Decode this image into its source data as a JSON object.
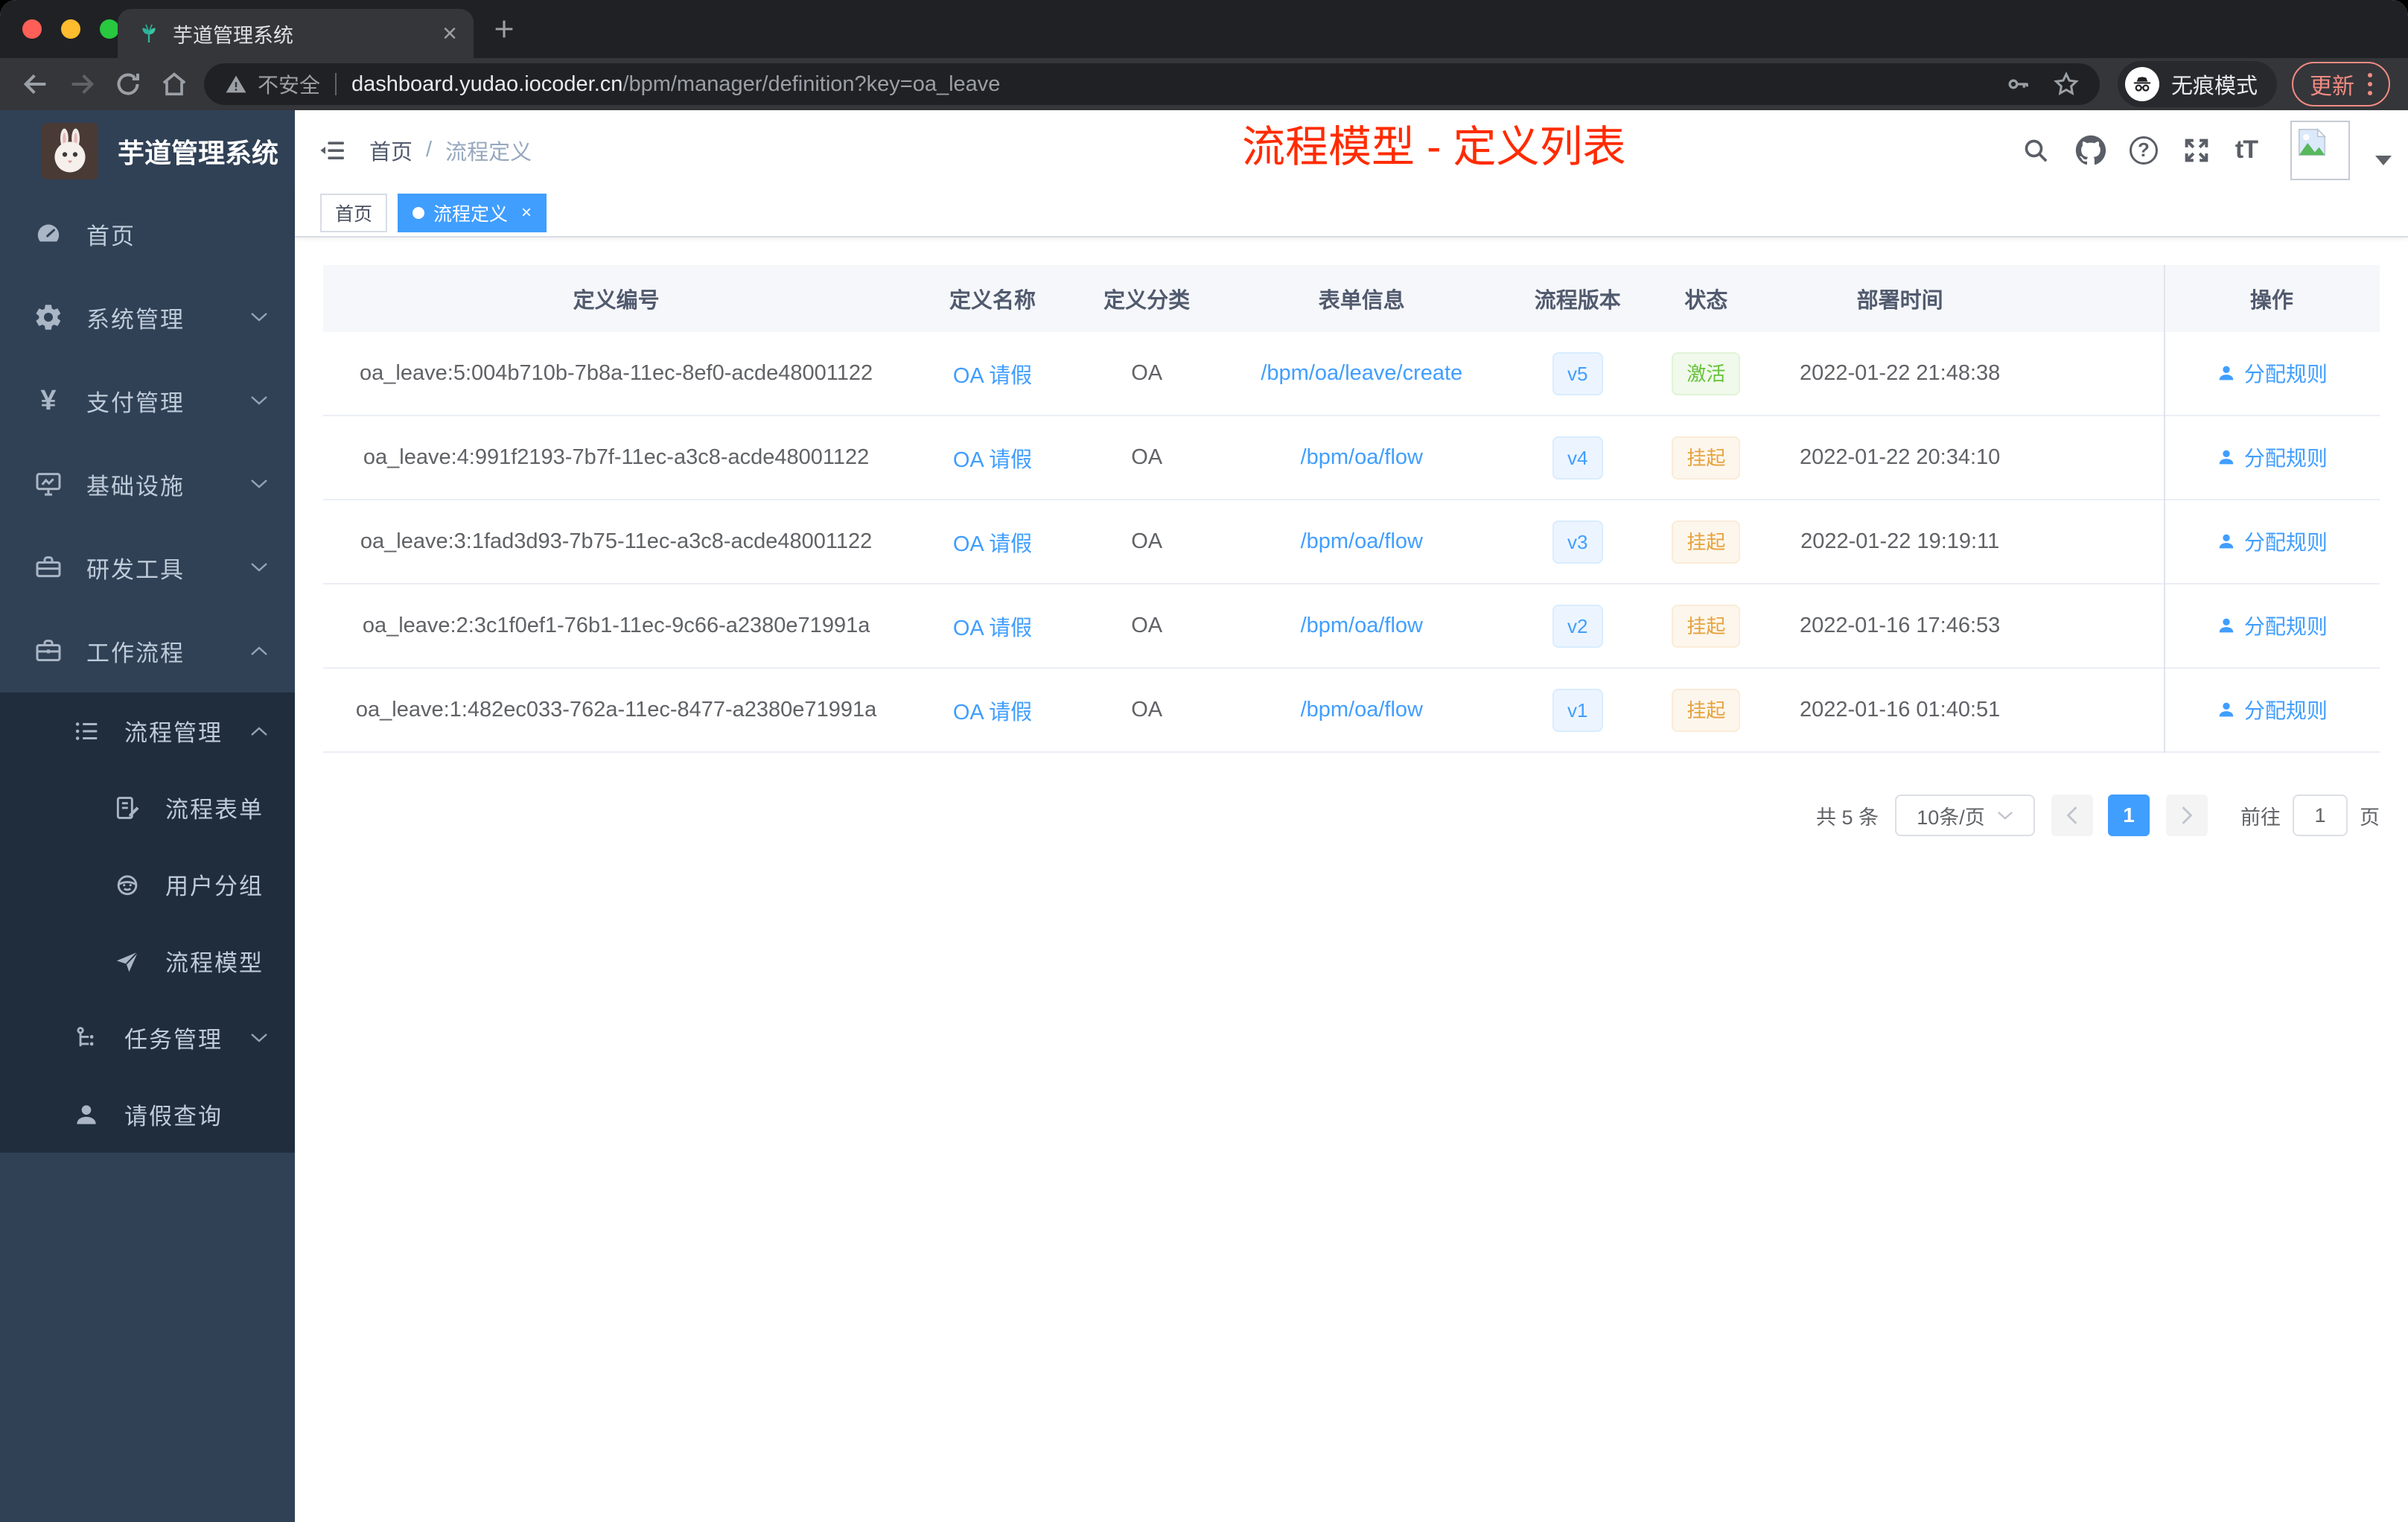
{
  "browser": {
    "tab": {
      "title": "芋道管理系统",
      "close": "×"
    },
    "toolbar": {
      "security_label": "不安全",
      "url_host": "dashboard.yudao.iocoder.cn",
      "url_path": "/bpm/manager/definition?key=oa_leave",
      "incognito_label": "无痕模式",
      "update_label": "更新"
    }
  },
  "sidebar": {
    "logo_title": "芋道管理系统",
    "menu": [
      {
        "label": "首页",
        "icon": "gauge-icon"
      },
      {
        "label": "系统管理",
        "icon": "gear-icon"
      },
      {
        "label": "支付管理",
        "icon": "yen-icon"
      },
      {
        "label": "基础设施",
        "icon": "monitor-icon"
      },
      {
        "label": "研发工具",
        "icon": "toolbox-icon"
      },
      {
        "label": "工作流程",
        "icon": "briefcase-icon"
      }
    ],
    "submenu": [
      {
        "label": "流程管理",
        "icon": "list-icon"
      },
      {
        "label": "流程表单",
        "icon": "form-icon"
      },
      {
        "label": "用户分组",
        "icon": "robot-icon"
      },
      {
        "label": "流程模型",
        "icon": "plane-icon"
      },
      {
        "label": "任务管理",
        "icon": "tree-icon"
      },
      {
        "label": "请假查询",
        "icon": "user-icon"
      }
    ]
  },
  "navbar": {
    "breadcrumb": {
      "items": [
        "首页",
        "流程定义"
      ],
      "separator": "/"
    },
    "annotation": {
      "text": "流程模型 - 定义列表",
      "color": "#ff2b00"
    }
  },
  "tags": [
    {
      "label": "首页",
      "active": false
    },
    {
      "label": "流程定义",
      "active": true,
      "close": "×"
    }
  ],
  "table": {
    "columns": [
      "定义编号",
      "定义名称",
      "定义分类",
      "表单信息",
      "流程版本",
      "状态",
      "部署时间",
      "操作"
    ],
    "rows": [
      {
        "id": "oa_leave:5:004b710b-7b8a-11ec-8ef0-acde48001122",
        "name": "OA 请假",
        "category": "OA",
        "form": "/bpm/oa/leave/create",
        "version": "v5",
        "status": "激活",
        "status_type": "success",
        "time": "2022-01-22 21:48:38",
        "action": "分配规则"
      },
      {
        "id": "oa_leave:4:991f2193-7b7f-11ec-a3c8-acde48001122",
        "name": "OA 请假",
        "category": "OA",
        "form": "/bpm/oa/flow",
        "version": "v4",
        "status": "挂起",
        "status_type": "warning",
        "time": "2022-01-22 20:34:10",
        "action": "分配规则"
      },
      {
        "id": "oa_leave:3:1fad3d93-7b75-11ec-a3c8-acde48001122",
        "name": "OA 请假",
        "category": "OA",
        "form": "/bpm/oa/flow",
        "version": "v3",
        "status": "挂起",
        "status_type": "warning",
        "time": "2022-01-22 19:19:11",
        "action": "分配规则"
      },
      {
        "id": "oa_leave:2:3c1f0ef1-76b1-11ec-9c66-a2380e71991a",
        "name": "OA 请假",
        "category": "OA",
        "form": "/bpm/oa/flow",
        "version": "v2",
        "status": "挂起",
        "status_type": "warning",
        "time": "2022-01-16 17:46:53",
        "action": "分配规则"
      },
      {
        "id": "oa_leave:1:482ec033-762a-11ec-8477-a2380e71991a",
        "name": "OA 请假",
        "category": "OA",
        "form": "/bpm/oa/flow",
        "version": "v1",
        "status": "挂起",
        "status_type": "warning",
        "time": "2022-01-16 01:40:51",
        "action": "分配规则"
      }
    ]
  },
  "pagination": {
    "total": "共 5 条",
    "page_size": "10条/页",
    "current_page": "1",
    "goto": "前往",
    "goto_value": "1",
    "page_unit": "页"
  },
  "colors": {
    "accent": "#409eff",
    "success": "#67c23a",
    "warning": "#e6a23c",
    "annotation_red": "#ff2b00",
    "sidebar_bg": "#304156",
    "submenu_bg": "#1f2d3d"
  }
}
